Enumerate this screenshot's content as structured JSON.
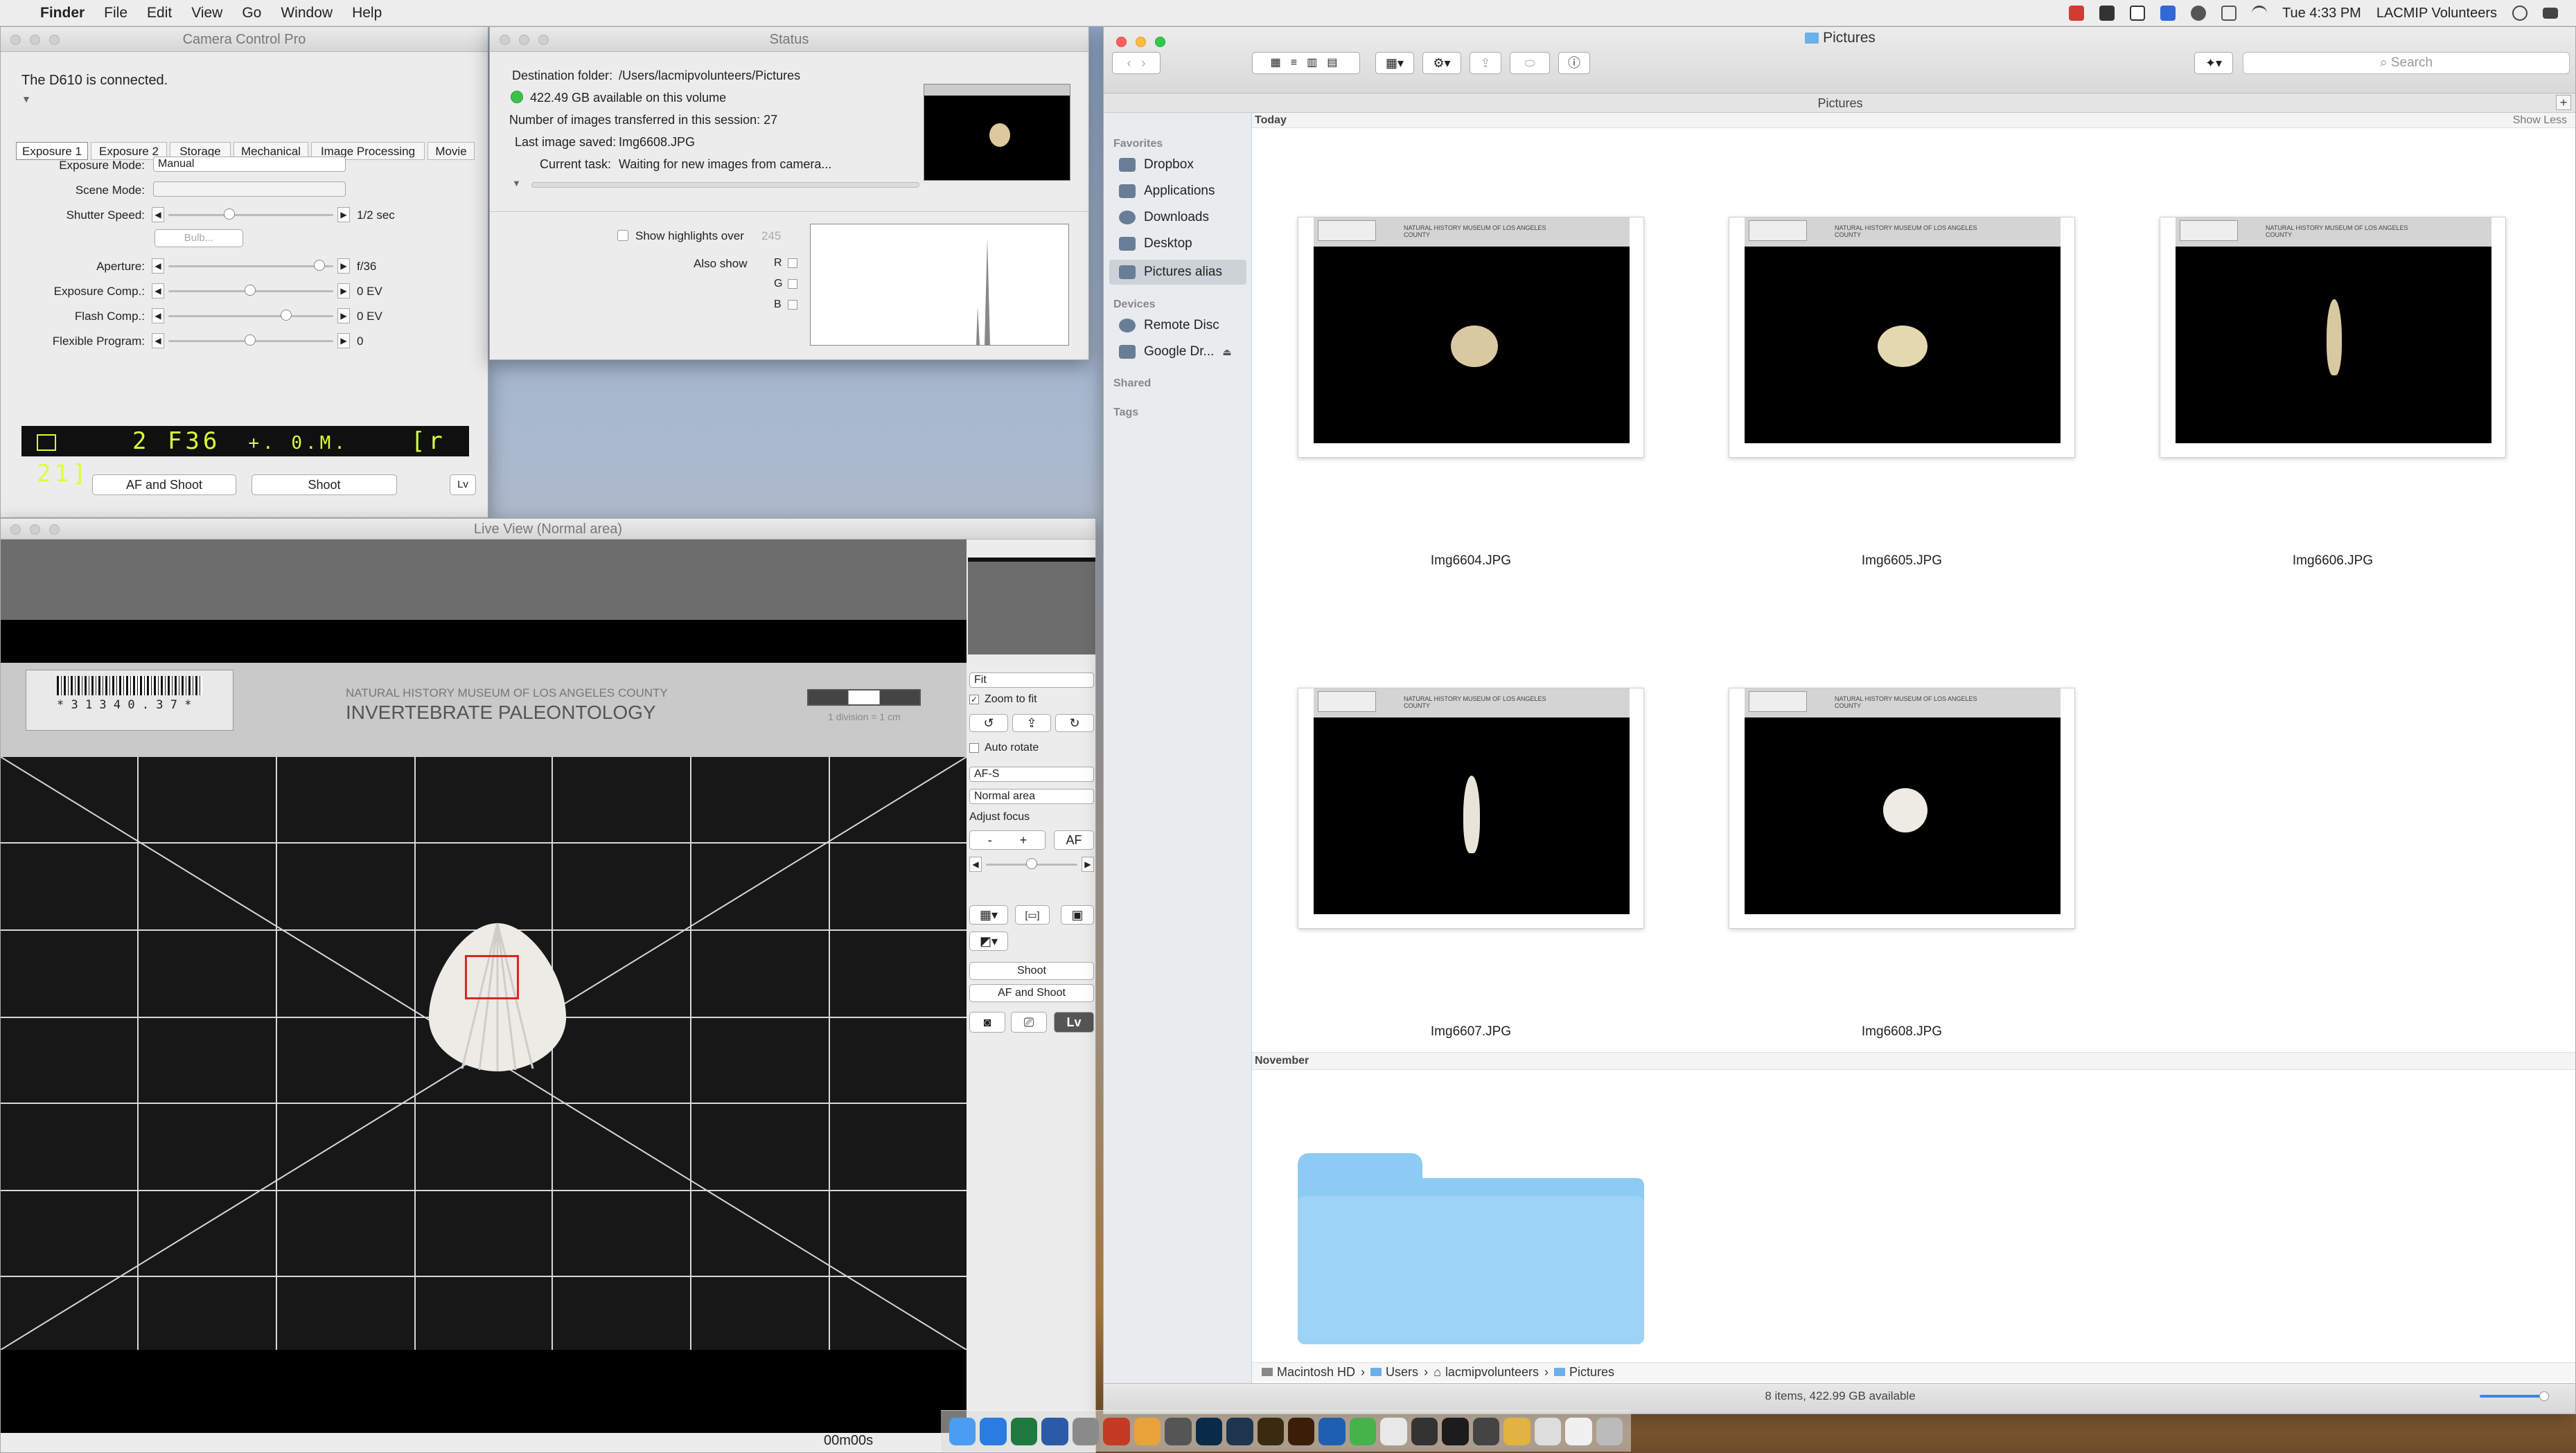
{
  "menubar": {
    "app": "Finder",
    "items": [
      "File",
      "Edit",
      "View",
      "Go",
      "Window",
      "Help"
    ],
    "clock": "Tue 4:33 PM",
    "user": "LACMIP Volunteers"
  },
  "ccp": {
    "title": "Camera Control Pro",
    "connected": "The D610 is connected.",
    "tabs": [
      "Exposure 1",
      "Exposure 2",
      "Storage",
      "Mechanical",
      "Image Processing",
      "Movie"
    ],
    "exposure_mode_label": "Exposure Mode:",
    "exposure_mode": "Manual",
    "scene_mode_label": "Scene Mode:",
    "shutter_label": "Shutter Speed:",
    "shutter_value": "1/2 sec",
    "bulb": "Bulb...",
    "aperture_label": "Aperture:",
    "aperture_value": "f/36",
    "exp_comp_label": "Exposure Comp.:",
    "exp_comp_value": "0 EV",
    "flash_comp_label": "Flash Comp.:",
    "flash_comp_value": "0 EV",
    "flex_label": "Flexible Program:",
    "flex_value": "0",
    "lcd_left": "2  F36",
    "lcd_mid": "+.  0.M.",
    "lcd_right": "[r 21]",
    "af_shoot": "AF and Shoot",
    "shoot": "Shoot",
    "lv": "Lv"
  },
  "status": {
    "title": "Status",
    "dest_label": "Destination folder:",
    "dest_value": "/Users/lacmipvolunteers/Pictures",
    "space": "422.49 GB available on this volume",
    "count": "Number of images transferred in this session: 27",
    "last_label": "Last image saved:",
    "last_value": "Img6608.JPG",
    "task_label": "Current task:",
    "task_value": "Waiting for new images from camera...",
    "highlights": "Show highlights over",
    "highlights_value": "245",
    "also_show": "Also show",
    "channels": [
      "R",
      "G",
      "B"
    ]
  },
  "liveview": {
    "title": "Live View (Normal area)",
    "museum": "NATURAL HISTORY MUSEUM OF LOS ANGELES COUNTY",
    "dept": "INVERTEBRATE PALEONTOLOGY",
    "barcode_num": "* 3 1 3 4 0 . 3 7 *",
    "scale_note": "1 division = 1 cm",
    "fit": "Fit",
    "zoom_to_fit": "Zoom to fit",
    "auto_rotate": "Auto rotate",
    "af_mode": "AF-S",
    "area_mode": "Normal area",
    "adjust_focus": "Adjust focus",
    "minus": "-",
    "plus": "+",
    "af": "AF",
    "shoot": "Shoot",
    "af_shoot": "AF and Shoot",
    "lv": "Lv",
    "timer": "00m00s"
  },
  "finder": {
    "title": "Pictures",
    "path_bar_title": "Pictures",
    "search_placeholder": "Search",
    "sidebar": {
      "favorites_head": "Favorites",
      "favorites": [
        "Dropbox",
        "Applications",
        "Downloads",
        "Desktop",
        "Pictures alias"
      ],
      "devices_head": "Devices",
      "devices": [
        "Remote Disc",
        "Google Dr..."
      ],
      "shared_head": "Shared",
      "tags_head": "Tags"
    },
    "today": "Today",
    "show_less": "Show Less",
    "files": [
      "Img6604.JPG",
      "Img6605.JPG",
      "Img6606.JPG",
      "Img6607.JPG",
      "Img6608.JPG"
    ],
    "november": "November",
    "breadcrumb": [
      "Macintosh HD",
      "Users",
      "lacmipvolunteers",
      "Pictures"
    ],
    "status": "8 items, 422.99 GB available",
    "thumb_caption": "NATURAL HISTORY MUSEUM OF LOS ANGELES COUNTY"
  }
}
